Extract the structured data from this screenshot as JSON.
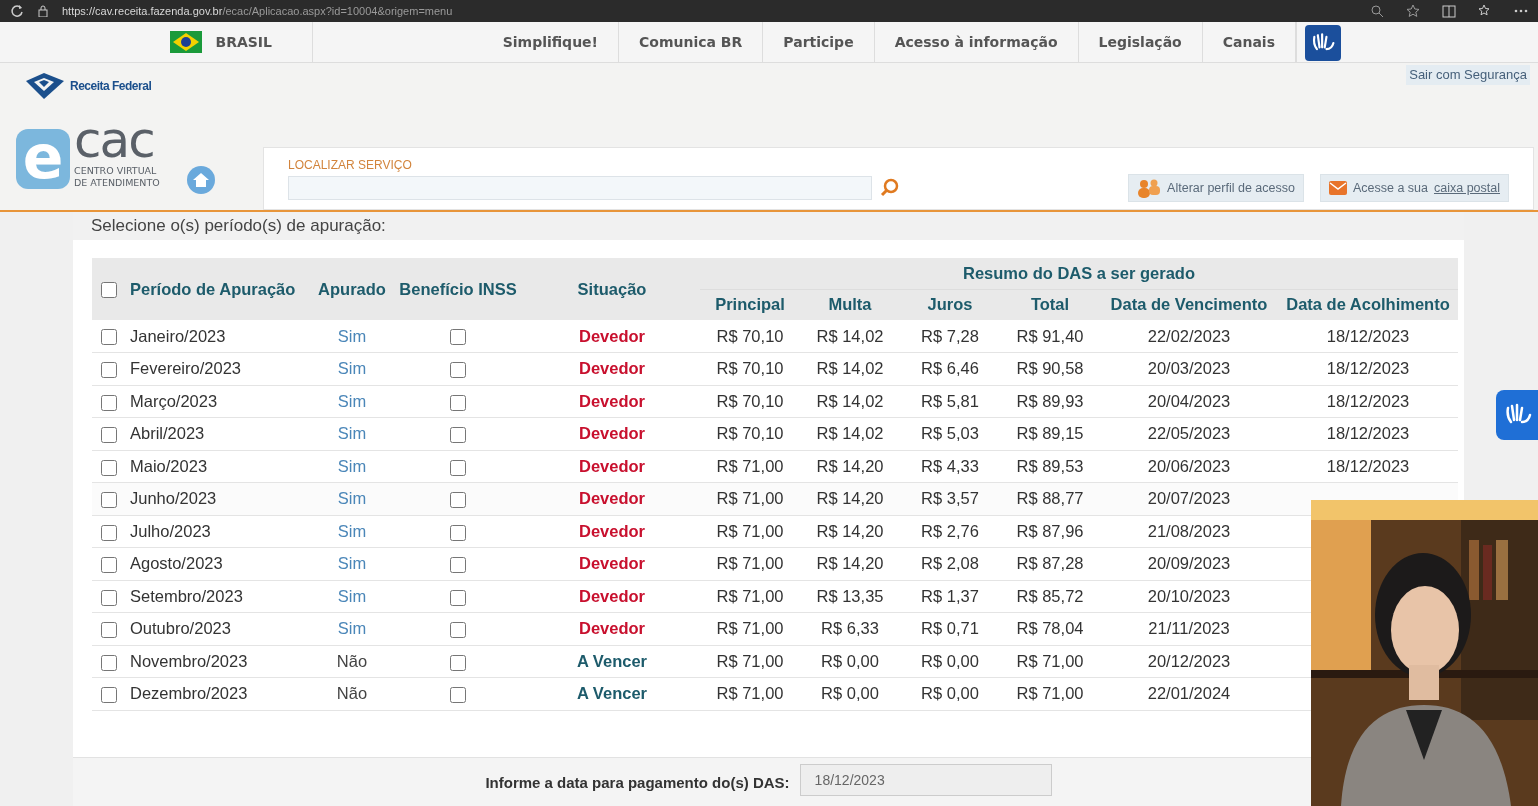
{
  "browser": {
    "url_host": "https://cav.receita.fazenda.gov.br",
    "url_path": "/ecac/Aplicacao.aspx?id=10004&origem=menu"
  },
  "gov_bar": {
    "country": "BRASIL",
    "links": [
      "Simplifique!",
      "Comunica BR",
      "Participe",
      "Acesso à informação",
      "Legislação",
      "Canais"
    ]
  },
  "header": {
    "brand": "Receita Federal",
    "logo_e": "e",
    "logo_text": "cac",
    "logo_subtitle_1": "CENTRO VIRTUAL",
    "logo_subtitle_2": "DE ATENDIMENTO",
    "logout": "Sair com Segurança",
    "search_label": "LOCALIZAR SERVIÇO",
    "profile_button": "Alterar perfil de acesso",
    "mailbox_prefix": "Acesse a sua",
    "mailbox_link": "caixa postal"
  },
  "section_title": "Selecione o(s) período(s) de apuração:",
  "table": {
    "select_all_checked": false,
    "columns": [
      "Período de Apuração",
      "Apurado",
      "Benefício INSS",
      "Situação"
    ],
    "group_heading": "Resumo do DAS a ser gerado",
    "sub_columns": [
      "Principal",
      "Multa",
      "Juros",
      "Total",
      "Data de Vencimento",
      "Data de Acolhimento"
    ],
    "rows": [
      {
        "period": "Janeiro/2023",
        "checked": false,
        "apurado": "Sim",
        "apurado_link": true,
        "inss_checked": false,
        "situacao": "Devedor",
        "kind": "devedor",
        "principal": "R$ 70,10",
        "multa": "R$ 14,02",
        "juros": "R$ 7,28",
        "total": "R$ 91,40",
        "vencimento": "22/02/2023",
        "acolhimento": "18/12/2023"
      },
      {
        "period": "Fevereiro/2023",
        "checked": false,
        "apurado": "Sim",
        "apurado_link": true,
        "inss_checked": false,
        "situacao": "Devedor",
        "kind": "devedor",
        "principal": "R$ 70,10",
        "multa": "R$ 14,02",
        "juros": "R$ 6,46",
        "total": "R$ 90,58",
        "vencimento": "20/03/2023",
        "acolhimento": "18/12/2023"
      },
      {
        "period": "Março/2023",
        "checked": false,
        "apurado": "Sim",
        "apurado_link": true,
        "inss_checked": false,
        "situacao": "Devedor",
        "kind": "devedor",
        "principal": "R$ 70,10",
        "multa": "R$ 14,02",
        "juros": "R$ 5,81",
        "total": "R$ 89,93",
        "vencimento": "20/04/2023",
        "acolhimento": "18/12/2023"
      },
      {
        "period": "Abril/2023",
        "checked": false,
        "apurado": "Sim",
        "apurado_link": true,
        "inss_checked": false,
        "situacao": "Devedor",
        "kind": "devedor",
        "principal": "R$ 70,10",
        "multa": "R$ 14,02",
        "juros": "R$ 5,03",
        "total": "R$ 89,15",
        "vencimento": "22/05/2023",
        "acolhimento": "18/12/2023"
      },
      {
        "period": "Maio/2023",
        "checked": false,
        "apurado": "Sim",
        "apurado_link": true,
        "inss_checked": false,
        "situacao": "Devedor",
        "kind": "devedor",
        "principal": "R$ 71,00",
        "multa": "R$ 14,20",
        "juros": "R$ 4,33",
        "total": "R$ 89,53",
        "vencimento": "20/06/2023",
        "acolhimento": "18/12/2023"
      },
      {
        "period": "Junho/2023",
        "checked": false,
        "apurado": "Sim",
        "apurado_link": true,
        "inss_checked": false,
        "situacao": "Devedor",
        "kind": "devedor",
        "principal": "R$ 71,00",
        "multa": "R$ 14,20",
        "juros": "R$ 3,57",
        "total": "R$ 88,77",
        "vencimento": "20/07/2023"
      },
      {
        "period": "Julho/2023",
        "checked": false,
        "apurado": "Sim",
        "apurado_link": true,
        "inss_checked": false,
        "situacao": "Devedor",
        "kind": "devedor",
        "principal": "R$ 71,00",
        "multa": "R$ 14,20",
        "juros": "R$ 2,76",
        "total": "R$ 87,96",
        "vencimento": "21/08/2023"
      },
      {
        "period": "Agosto/2023",
        "checked": false,
        "apurado": "Sim",
        "apurado_link": true,
        "inss_checked": false,
        "situacao": "Devedor",
        "kind": "devedor",
        "principal": "R$ 71,00",
        "multa": "R$ 14,20",
        "juros": "R$ 2,08",
        "total": "R$ 87,28",
        "vencimento": "20/09/2023"
      },
      {
        "period": "Setembro/2023",
        "checked": false,
        "apurado": "Sim",
        "apurado_link": true,
        "inss_checked": false,
        "situacao": "Devedor",
        "kind": "devedor",
        "principal": "R$ 71,00",
        "multa": "R$ 13,35",
        "juros": "R$ 1,37",
        "total": "R$ 85,72",
        "vencimento": "20/10/2023"
      },
      {
        "period": "Outubro/2023",
        "checked": false,
        "apurado": "Sim",
        "apurado_link": true,
        "inss_checked": false,
        "situacao": "Devedor",
        "kind": "devedor",
        "principal": "R$ 71,00",
        "multa": "R$ 6,33",
        "juros": "R$ 0,71",
        "total": "R$ 78,04",
        "vencimento": "21/11/2023"
      },
      {
        "period": "Novembro/2023",
        "checked": false,
        "apurado": "Não",
        "apurado_link": false,
        "inss_checked": false,
        "situacao": "A Vencer",
        "kind": "a_vencer",
        "principal": "R$ 71,00",
        "multa": "R$ 0,00",
        "juros": "R$ 0,00",
        "total": "R$ 71,00",
        "vencimento": "20/12/2023"
      },
      {
        "period": "Dezembro/2023",
        "checked": false,
        "apurado": "Não",
        "apurado_link": false,
        "inss_checked": false,
        "situacao": "A Vencer",
        "kind": "a_vencer",
        "principal": "R$ 71,00",
        "multa": "R$ 0,00",
        "juros": "R$ 0,00",
        "total": "R$ 71,00",
        "vencimento": "22/01/2024"
      }
    ]
  },
  "payment_date": {
    "label": "Informe a data para pagamento do(s) DAS:",
    "value": "18/12/2023"
  }
}
